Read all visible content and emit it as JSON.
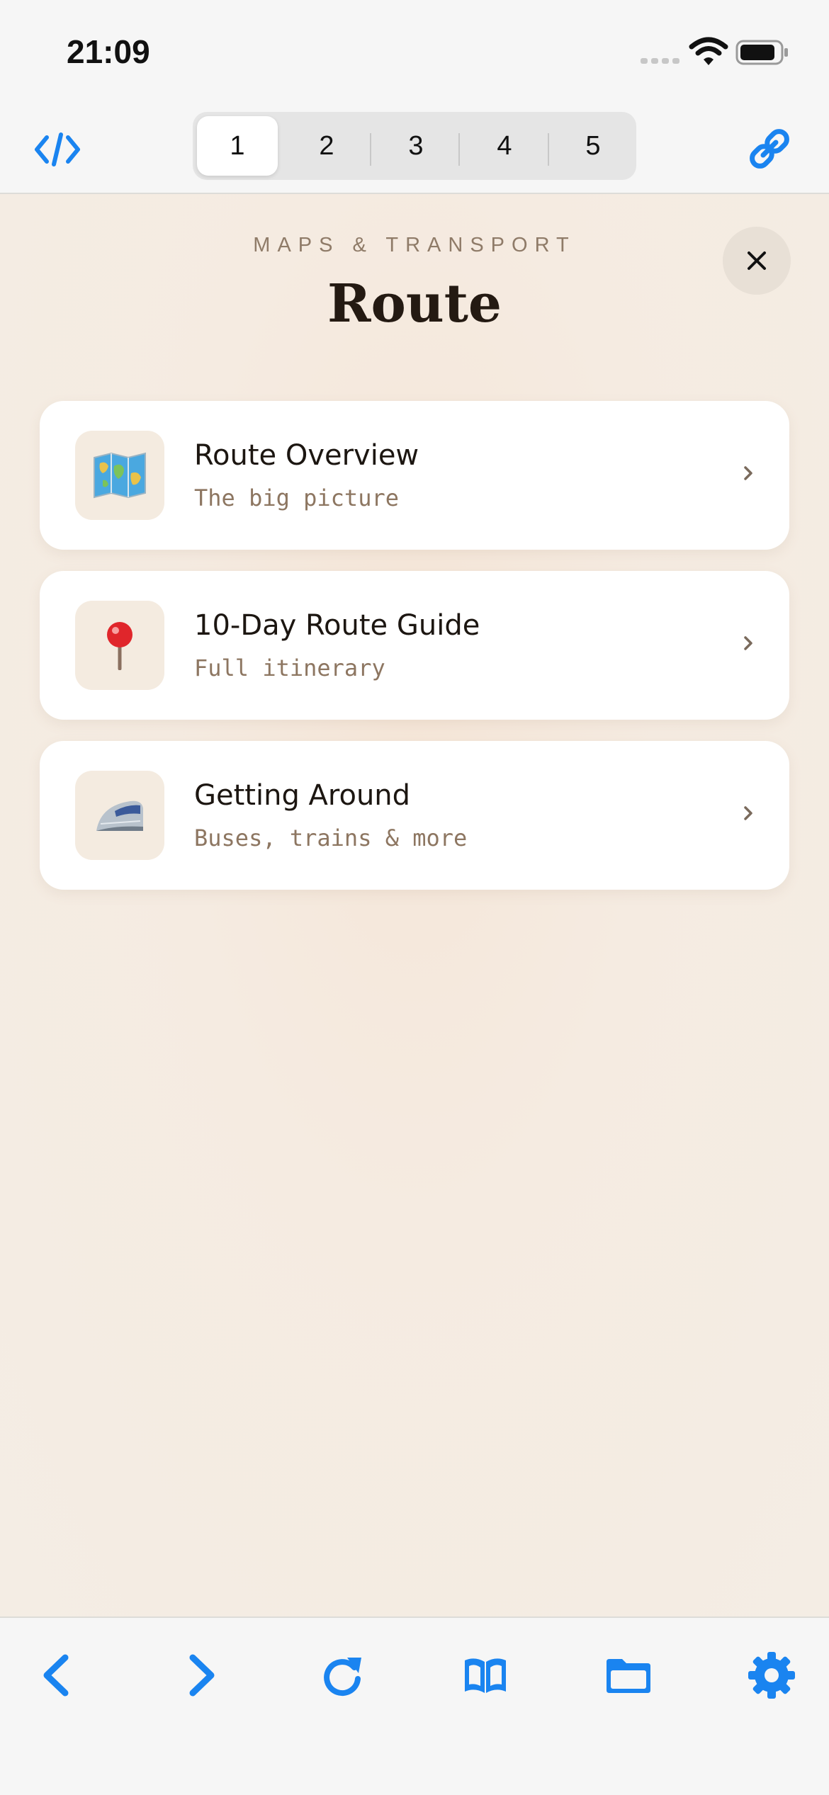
{
  "status_bar": {
    "time": "21:09"
  },
  "toolbar": {
    "code_icon": "code-icon",
    "link_icon": "link-icon",
    "tabs": [
      {
        "label": "1",
        "active": true
      },
      {
        "label": "2",
        "active": false
      },
      {
        "label": "3",
        "active": false
      },
      {
        "label": "4",
        "active": false
      },
      {
        "label": "5",
        "active": false
      }
    ]
  },
  "header": {
    "eyebrow": "MAPS & TRANSPORT",
    "title": "Route",
    "close_icon": "close-icon"
  },
  "cards": [
    {
      "icon": "world-map-icon",
      "title": "Route Overview",
      "subtitle": "The big picture"
    },
    {
      "icon": "round-pushpin-icon",
      "title": "10-Day Route Guide",
      "subtitle": "Full itinerary"
    },
    {
      "icon": "bullet-train-icon",
      "title": "Getting Around",
      "subtitle": "Buses, trains & more"
    }
  ],
  "bottom_bar": {
    "items": [
      "back-icon",
      "forward-icon",
      "reload-icon",
      "bookmarks-icon",
      "folder-icon",
      "settings-icon"
    ]
  },
  "colors": {
    "accent": "#1a84f0",
    "background": "#f5ebe1",
    "card": "#ffffff",
    "title": "#241a12",
    "muted": "#8d7661"
  }
}
